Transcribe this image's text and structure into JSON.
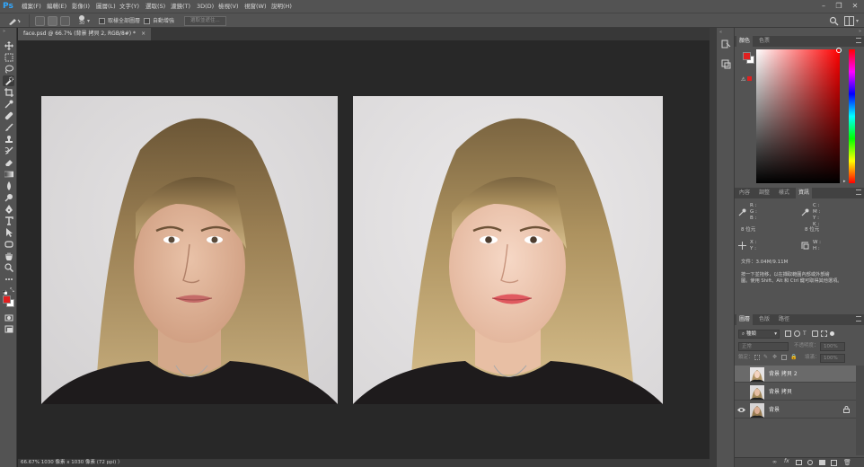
{
  "app": {
    "logo": "Ps"
  },
  "menu": [
    "檔案(F)",
    "編輯(E)",
    "影像(I)",
    "圖層(L)",
    "文字(Y)",
    "選取(S)",
    "濾鏡(T)",
    "3D(D)",
    "檢視(V)",
    "視窗(W)",
    "說明(H)"
  ],
  "options": {
    "brush_size": "30",
    "sample_all_layers": "取樣全部圖層",
    "auto_enhance": "自動增強",
    "select_subject": "選取並遮住..."
  },
  "document": {
    "tab_title": "face.psd @ 66.7% (背景 拷貝 2, RGB/8#) *",
    "close": "×",
    "status": "66.67%    1030 像素 x 1030 像素 (72 ppi)  〉"
  },
  "color_panel": {
    "tabs": [
      "顏色",
      "色票"
    ],
    "foreground": "#e02020",
    "background": "#ffffff"
  },
  "info_panel": {
    "tabs": [
      "內容",
      "調整",
      "樣式",
      "資訊"
    ],
    "rgb_labels": [
      "R :",
      "G :",
      "B :"
    ],
    "cmyk_labels": [
      "C :",
      "M :",
      "Y :",
      "K :"
    ],
    "bit_left": "8 位元",
    "bit_right": "8 位元",
    "xy_labels": [
      "X :",
      "Y :"
    ],
    "wh_labels": [
      "W :",
      "H :"
    ],
    "doc_size": "文件：3.04M/9.11M",
    "hint_line1": "按一下並拖移，以在擷取範圍內部或外部繪",
    "hint_line2": "圖。使用 Shift、Alt 和 Ctrl 鍵可取得其他選項。"
  },
  "layers_panel": {
    "tabs": [
      "圖層",
      "色版",
      "路徑"
    ],
    "filter_label": "種類",
    "blend_mode": "正常",
    "opacity_label": "不透明度：",
    "opacity_value": "100%",
    "lock_label": "鎖定：",
    "fill_label": "填滿：",
    "fill_value": "100%",
    "layers": [
      {
        "name": "背景 拷貝 2",
        "visible": false,
        "selected": true
      },
      {
        "name": "背景 拷貝",
        "visible": false,
        "selected": false
      },
      {
        "name": "背景",
        "visible": true,
        "selected": false,
        "locked": true
      }
    ]
  },
  "colors": {
    "ps_blue": "#31a8ff",
    "menu_bg": "#535353",
    "canvas_bg": "#282828"
  }
}
